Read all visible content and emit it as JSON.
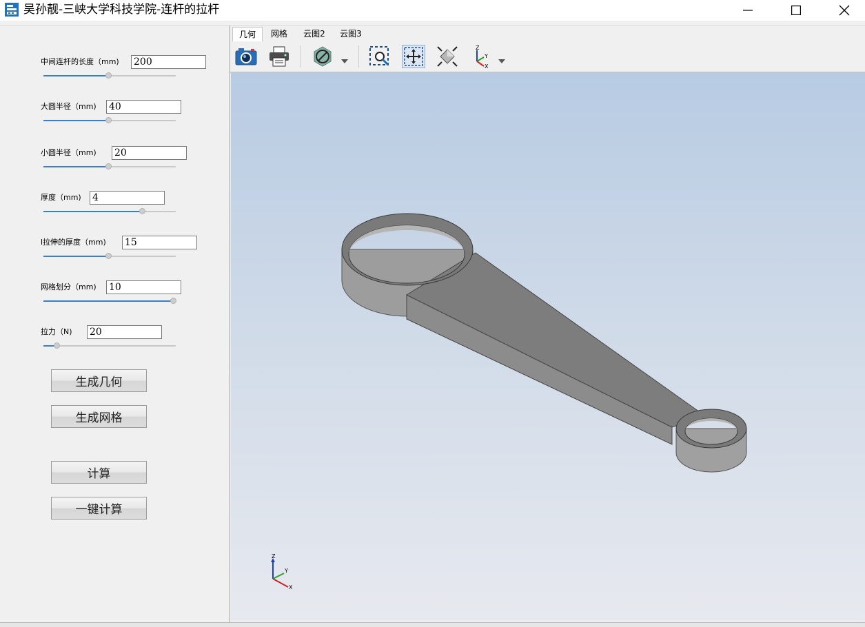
{
  "window": {
    "title": "吴孙靓-三峡大学科技学院-连杆的拉杆",
    "icon": "app-building-icon",
    "minimize_icon": "minimize-icon",
    "maximize_icon": "maximize-icon",
    "close_icon": "close-icon"
  },
  "params": [
    {
      "label": "中间连杆的长度（mm)",
      "value": "200",
      "slider_fraction": 0.5
    },
    {
      "label": "大圆半径（mm)",
      "value": "40",
      "slider_fraction": 0.5
    },
    {
      "label": "小圆半径（mm)",
      "value": "20",
      "slider_fraction": 0.5
    },
    {
      "label": "厚度（mm)",
      "value": "4",
      "slider_fraction": 0.76
    },
    {
      "label": "l拉伸的厚度（mm)",
      "value": "15",
      "slider_fraction": 0.5
    },
    {
      "label": "网格划分（mm)",
      "value": "10",
      "slider_fraction": 1.0
    },
    {
      "label": "拉力（N)",
      "value": "20",
      "slider_fraction": 0.1
    }
  ],
  "buttons": {
    "gen_geometry": "生成几何",
    "gen_mesh": "生成网格",
    "compute": "计算",
    "one_click": "一键计算"
  },
  "tabs": [
    "几何",
    "网格",
    "云图2",
    "云图3"
  ],
  "active_tab": "几何",
  "toolbar": [
    {
      "icon": "camera-icon"
    },
    {
      "icon": "printer-icon"
    },
    {
      "icon": "no-clip-icon",
      "dropdown": true
    },
    {
      "icon": "zoom-window-icon"
    },
    {
      "icon": "pan-icon",
      "pressed": true
    },
    {
      "icon": "fit-all-icon"
    },
    {
      "icon": "axis-view-icon",
      "dropdown": true
    }
  ],
  "axis_triad": {
    "z": "Z",
    "y": "Y",
    "x": "X"
  },
  "colors": {
    "slider_fill": "#3b7ec4",
    "model_top": "#7a7a7a",
    "model_side": "#9c9c9c"
  }
}
